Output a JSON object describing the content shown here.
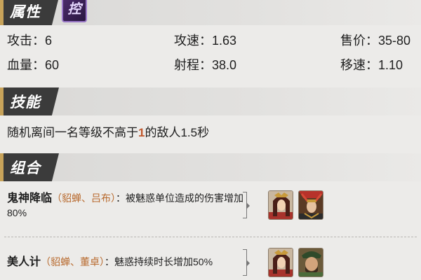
{
  "attributes": {
    "header": "属性",
    "badge": "控",
    "stats": {
      "attack": "攻击：6",
      "attack_speed": "攻速：1.63",
      "price": "售价：35-80",
      "hp": "血量：60",
      "range": "射程：38.0",
      "move_speed": "移速：1.10"
    }
  },
  "skill": {
    "header": "技能",
    "desc_before": "随机离间一名等级不高于",
    "desc_highlight": "1",
    "desc_after": "的敌人1.5秒"
  },
  "combos": {
    "header": "组合",
    "items": [
      {
        "name": "鬼神降临",
        "members": "（貂蝉、吕布）",
        "effect": "：被魅惑单位造成的伤害增加80%",
        "portraits": [
          "diaochan-portrait-icon",
          "lvbu-portrait-icon"
        ]
      },
      {
        "name": "美人计",
        "members": "（貂蝉、董卓）",
        "effect": "：魅惑持续时长增加50%",
        "portraits": [
          "diaochan-portrait-icon",
          "dongzhuo-portrait-icon"
        ]
      }
    ]
  },
  "colors": {
    "background": "#ecebe9",
    "header_tag": "#3b3b3b",
    "member_text": "#b86a2e",
    "highlight": "#c0582e",
    "badge_purple": "#4b2b6b"
  }
}
